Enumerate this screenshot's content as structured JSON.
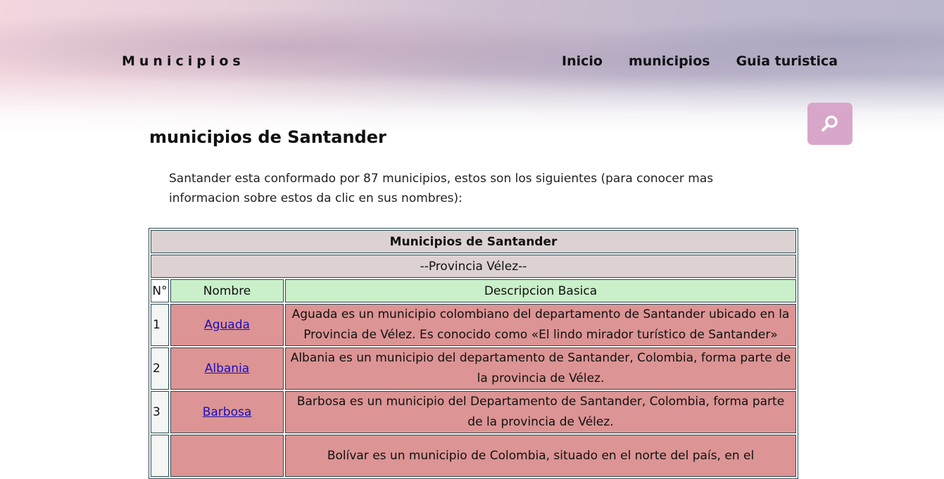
{
  "header": {
    "brand": "Municipios",
    "nav": [
      {
        "label": "Inicio"
      },
      {
        "label": "municipios"
      },
      {
        "label": "Guia turistica"
      }
    ],
    "search_icon": "search-icon",
    "search_button_color": "#d8a6c8"
  },
  "main": {
    "title": "municipios de Santander",
    "intro": "Santander esta conformado por 87 municipios, estos son los siguientes (para conocer mas informacion sobre estos da clic en sus nombres):"
  },
  "table": {
    "caption": "Municipios de Santander",
    "province": "--Provincia Vélez--",
    "columns": [
      "N°",
      "Nombre",
      "Descripcion Basica"
    ],
    "rows": [
      {
        "num": "1",
        "name": "Aguada",
        "desc": "Aguada es un municipio colombiano del departamento de Santander ubicado en la Provincia de Vélez. Es conocido como «El lindo mirador turístico de Santander»"
      },
      {
        "num": "2",
        "name": "Albania",
        "desc": "Albania es un municipio del departamento de Santander, Colombia, forma parte de la provincia de Vélez."
      },
      {
        "num": "3",
        "name": "Barbosa",
        "desc": "Barbosa es un municipio del Departamento de Santander, Colombia, forma parte de la provincia de Vélez."
      },
      {
        "num": "",
        "name": "",
        "desc": "Bolívar es un municipio de Colombia, situado en el norte del país, en el"
      }
    ],
    "colors": {
      "caption_bg": "#dcd2d2",
      "header_bg": "#c9f0c9",
      "cell_bg": "#dc9494",
      "link": "#1a0dbb"
    }
  }
}
